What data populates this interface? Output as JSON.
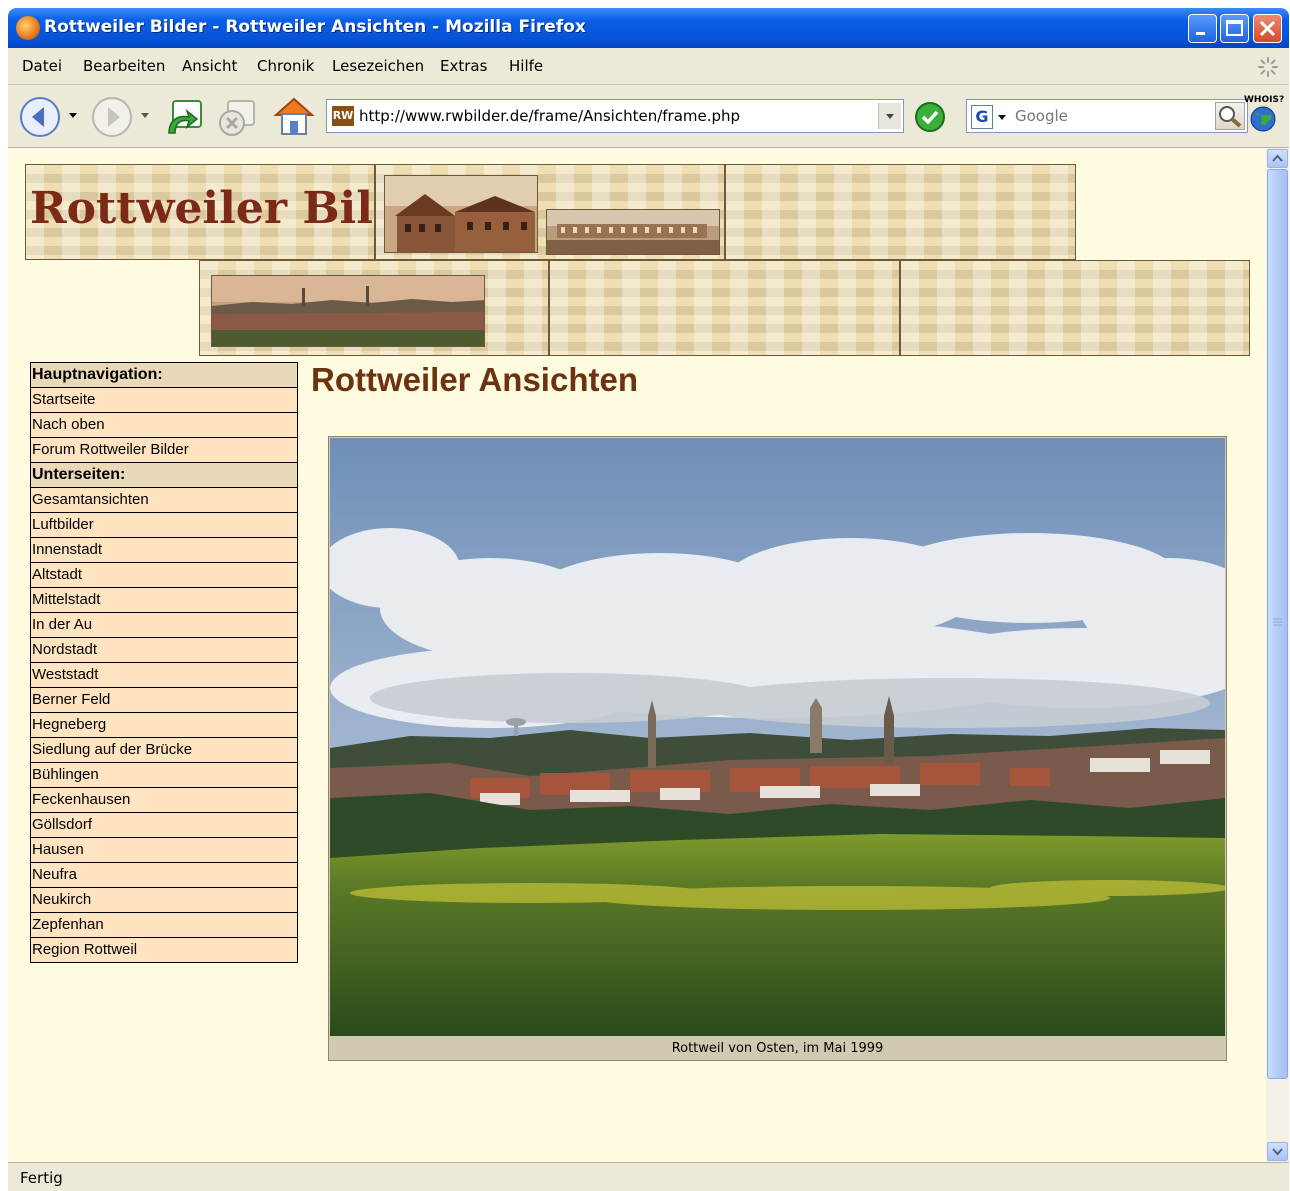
{
  "window": {
    "title": "Rottweiler Bilder - Rottweiler Ansichten - Mozilla Firefox"
  },
  "menubar": {
    "items": [
      "Datei",
      "Bearbeiten",
      "Ansicht",
      "Chronik",
      "Lesezeichen",
      "Extras",
      "Hilfe"
    ]
  },
  "toolbar": {
    "url": "http://www.rwbilder.de/frame/Ansichten/frame.php",
    "search_placeholder": "Google",
    "whois_label": "WHOIS?",
    "site_icon_label": "RW"
  },
  "banner": {
    "logo_text": "Rottweiler Bilder"
  },
  "nav": {
    "rows": [
      {
        "label": "Hauptnavigation:",
        "header": true
      },
      {
        "label": "Startseite"
      },
      {
        "label": "Nach oben"
      },
      {
        "label": "Forum Rottweiler Bilder"
      },
      {
        "label": "Unterseiten:",
        "header": true
      },
      {
        "label": "Gesamtansichten"
      },
      {
        "label": "Luftbilder"
      },
      {
        "label": "Innenstadt"
      },
      {
        "label": "Altstadt"
      },
      {
        "label": "Mittelstadt"
      },
      {
        "label": "In der Au"
      },
      {
        "label": "Nordstadt"
      },
      {
        "label": "Weststadt"
      },
      {
        "label": "Berner Feld"
      },
      {
        "label": "Hegneberg"
      },
      {
        "label": "Siedlung auf der Brücke"
      },
      {
        "label": "Bühlingen"
      },
      {
        "label": "Feckenhausen"
      },
      {
        "label": "Göllsdorf"
      },
      {
        "label": "Hausen"
      },
      {
        "label": "Neufra"
      },
      {
        "label": "Neukirch"
      },
      {
        "label": "Zepfenhan"
      },
      {
        "label": "Region Rottweil"
      }
    ]
  },
  "main": {
    "heading": "Rottweiler Ansichten",
    "caption": "Rottweil von Osten, im Mai 1999"
  },
  "statusbar": {
    "text": "Fertig"
  },
  "colors": {
    "page_bg": "#fffbe0",
    "nav_cell": "#ffe4c2",
    "nav_header": "#ead9b8",
    "heading": "#6b3310",
    "logo": "#7a2a16"
  }
}
